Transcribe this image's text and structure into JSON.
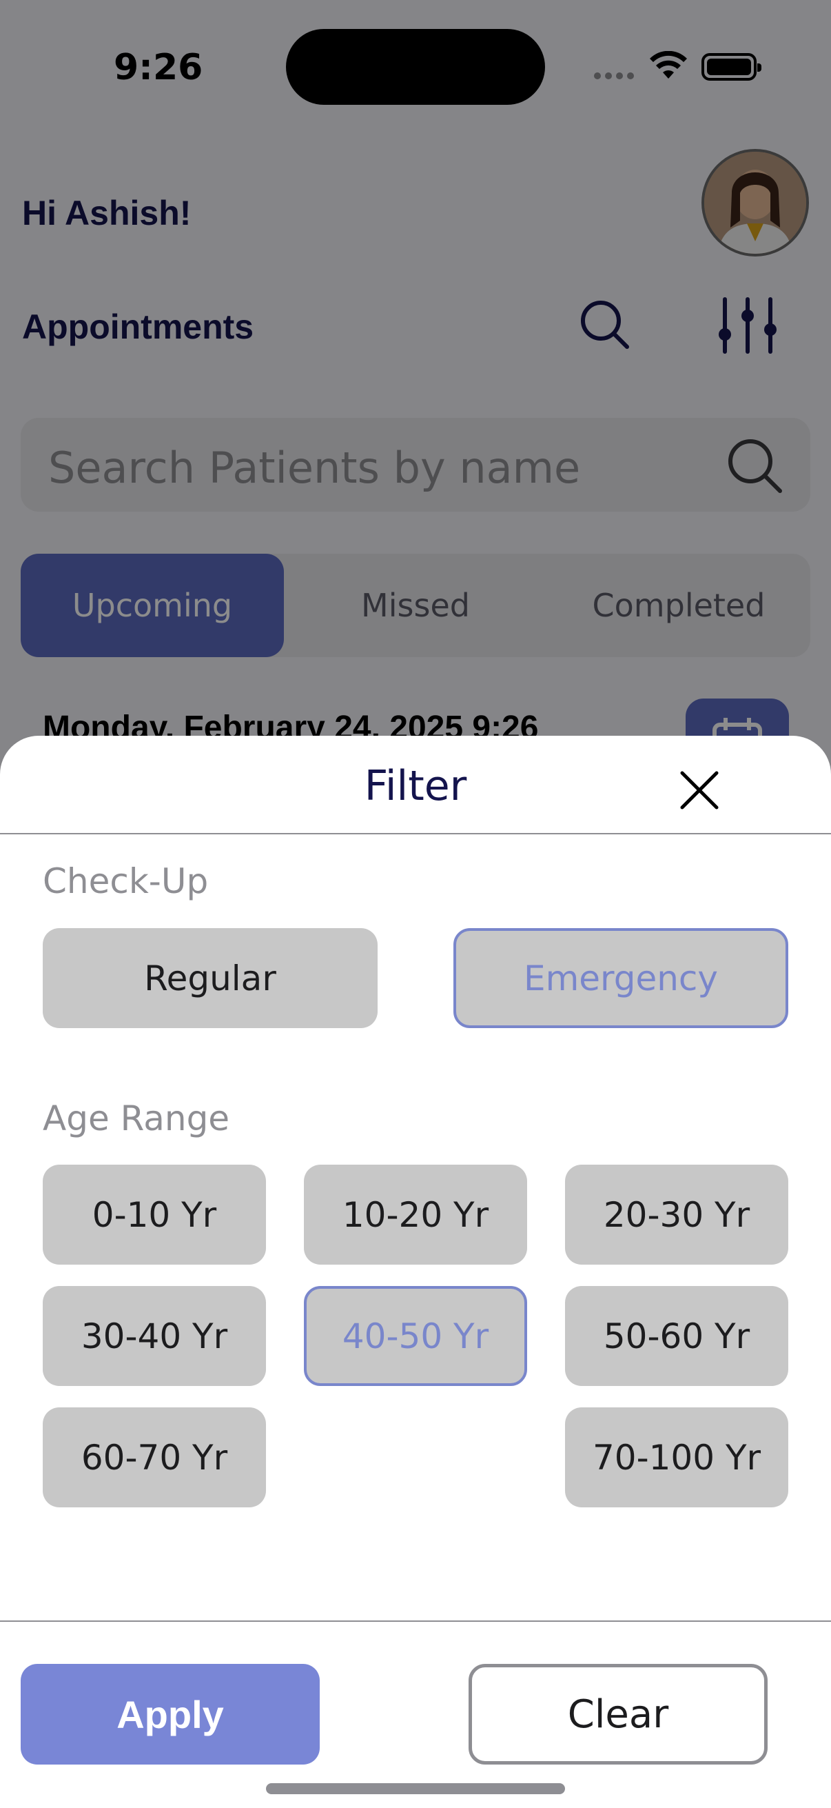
{
  "status_bar": {
    "time": "9:26"
  },
  "header": {
    "greeting": "Hi Ashish!",
    "title": "Appointments"
  },
  "search": {
    "placeholder": "Search Patients by name"
  },
  "tabs": [
    {
      "label": "Upcoming",
      "active": true
    },
    {
      "label": "Missed",
      "active": false
    },
    {
      "label": "Completed",
      "active": false
    }
  ],
  "appointment": {
    "date": "Monday, February 24, 2025 9:26"
  },
  "filter": {
    "title": "Filter",
    "checkup": {
      "label": "Check-Up",
      "options": [
        {
          "label": "Regular",
          "selected": false
        },
        {
          "label": "Emergency",
          "selected": true
        }
      ]
    },
    "age_range": {
      "label": "Age Range",
      "options": [
        {
          "label": "0-10 Yr",
          "selected": false
        },
        {
          "label": "10-20 Yr",
          "selected": false
        },
        {
          "label": "20-30 Yr",
          "selected": false
        },
        {
          "label": "30-40 Yr",
          "selected": false
        },
        {
          "label": "40-50 Yr",
          "selected": true
        },
        {
          "label": "50-60 Yr",
          "selected": false
        },
        {
          "label": "60-70 Yr",
          "selected": false
        },
        {
          "label": "70-100 Yr",
          "selected": false
        }
      ]
    },
    "apply_label": "Apply",
    "clear_label": "Clear"
  },
  "colors": {
    "primary": "#5c6bc0",
    "selected_accent": "#7986cb",
    "title_text": "#14144d"
  }
}
